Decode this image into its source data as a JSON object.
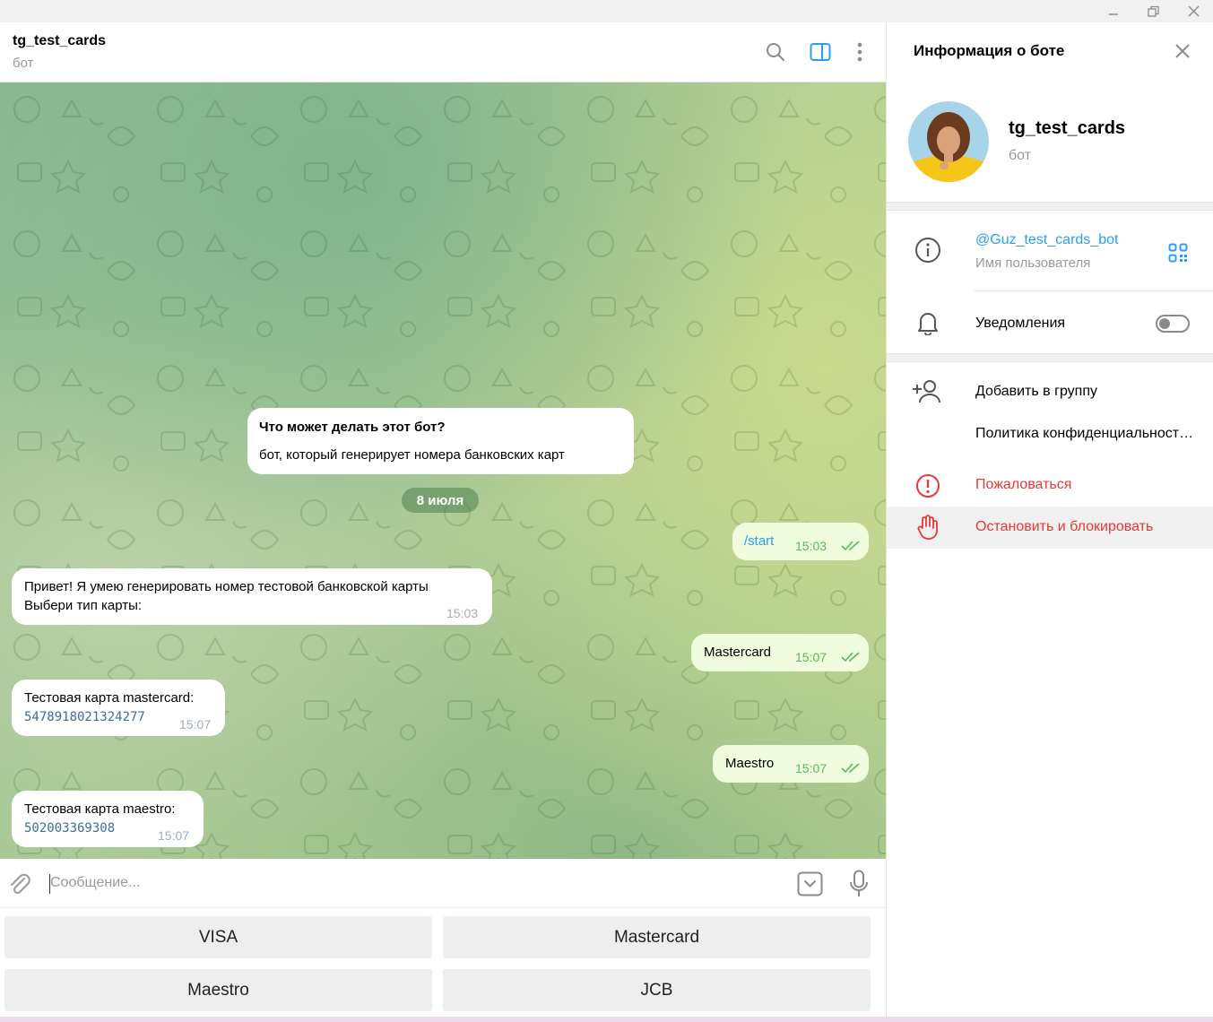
{
  "chat": {
    "title": "tg_test_cards",
    "subtitle": "бот"
  },
  "bot_info_card": {
    "heading": "Что может делать этот бот?",
    "text": "бот, который генерирует номера банковских карт"
  },
  "date_badge": "8 июля",
  "messages": [
    {
      "dir": "out",
      "text": "/start",
      "time": "15:03"
    },
    {
      "dir": "in",
      "line1": "Привет! Я умею генерировать номер тестовой банковской карты",
      "line2": "Выбери тип карты:",
      "time": "15:03"
    },
    {
      "dir": "out",
      "text": "Mastercard",
      "time": "15:07"
    },
    {
      "dir": "in",
      "line1": "Тестовая карта mastercard:",
      "code": "5478918021324277",
      "time": "15:07"
    },
    {
      "dir": "out",
      "text": "Maestro",
      "time": "15:07"
    },
    {
      "dir": "in",
      "line1": "Тестовая карта maestro:",
      "code": "502003369308",
      "time": "15:07"
    }
  ],
  "composer": {
    "placeholder": "Сообщение..."
  },
  "keyboard": [
    "VISA",
    "Mastercard",
    "Maestro",
    "JCB"
  ],
  "info_panel": {
    "title": "Информация о боте",
    "name": "tg_test_cards",
    "subtitle": "бот",
    "username": "@Guz_test_cards_bot",
    "username_label": "Имя пользователя",
    "notifications_label": "Уведомления",
    "notifications_on": false,
    "add_to_group": "Добавить в группу",
    "privacy_policy": "Политика конфиденциальност…",
    "report": "Пожаловаться",
    "stop_and_block": "Остановить и блокировать"
  },
  "colors": {
    "accent": "#2a9ef4",
    "danger": "#e53935",
    "outgoing_bubble": "#effdde",
    "read_check": "#5cb55a"
  },
  "icons": {
    "window": [
      "minimize-icon",
      "restore-icon",
      "close-icon"
    ],
    "header": [
      "search-icon",
      "sidebar-toggle-icon",
      "more-vertical-icon"
    ],
    "composer": [
      "attach-icon",
      "keyboard-toggle-icon",
      "microphone-icon"
    ],
    "info": [
      "close-icon",
      "info-icon",
      "qr-code-icon",
      "bell-icon",
      "add-user-icon",
      "report-icon",
      "stop-hand-icon"
    ]
  }
}
